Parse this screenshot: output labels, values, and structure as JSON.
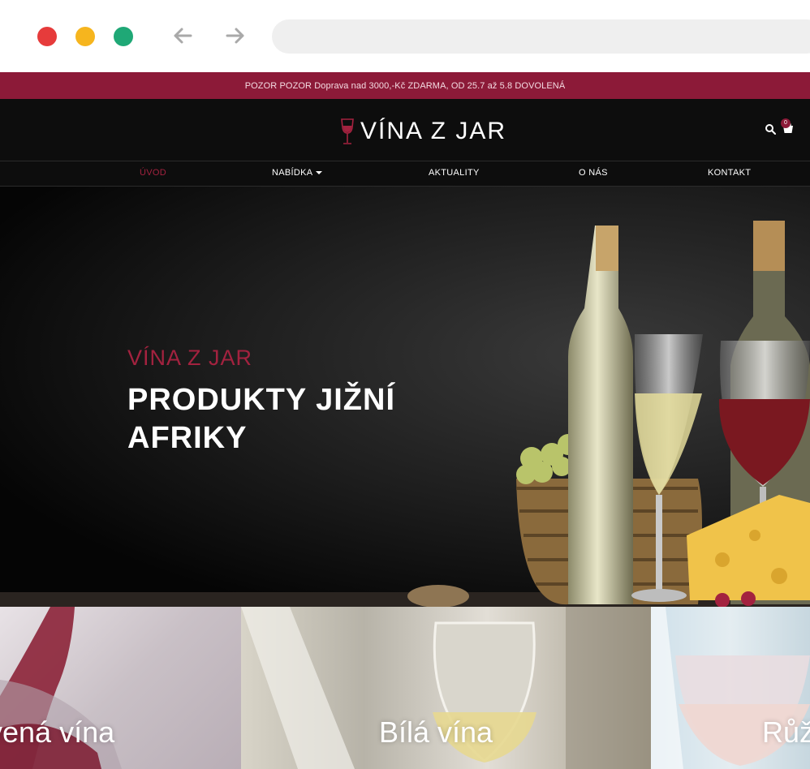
{
  "browser": {
    "window_controls": [
      "close",
      "minimize",
      "maximize"
    ],
    "nav_icons": [
      "back-arrow-icon",
      "forward-arrow-icon"
    ]
  },
  "announcement": {
    "text": "POZOR POZOR Doprava nad 3000,-Kč ZDARMA, OD 25.7 až 5.8 DOVOLENÁ"
  },
  "header": {
    "logo_text": "VÍNA Z JAR",
    "cart_count": "0",
    "icons": [
      "wine-glass-icon",
      "search-icon",
      "cart-icon"
    ]
  },
  "nav": {
    "items": [
      {
        "label": "ÚVOD",
        "active": true
      },
      {
        "label": "NABÍDKA",
        "has_dropdown": true
      },
      {
        "label": "AKTUALITY"
      },
      {
        "label": "O NÁS"
      },
      {
        "label": "KONTAKT"
      }
    ]
  },
  "hero": {
    "subtitle": "VÍNA Z JAR",
    "title": "PRODUKTY JIŽNÍ AFRIKY"
  },
  "categories": [
    {
      "label": "vená vína"
    },
    {
      "label": "Bílá vína"
    },
    {
      "label": "Růž"
    }
  ],
  "colors": {
    "brand": "#8c1a38",
    "accent": "#a3223f",
    "header_bg": "#0d0d0d"
  }
}
